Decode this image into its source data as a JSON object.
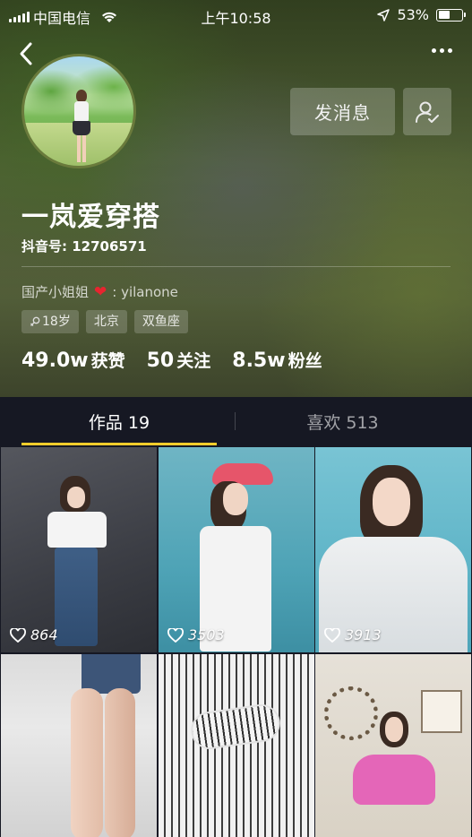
{
  "status_bar": {
    "carrier": "中国电信",
    "time": "上午10:58",
    "battery": "53%",
    "battery_level": 0.53
  },
  "profile": {
    "follow_button_label": "发消息",
    "nickname": "一岚爱穿搭",
    "douyin_id": "抖音号: 12706571",
    "bio_prefix": "国产小姐姐",
    "bio_suffix": ": yilanone",
    "tags": [
      "18岁",
      "北京",
      "双鱼座"
    ],
    "stats": [
      {
        "value": "49.0w",
        "label": "获赞"
      },
      {
        "value": "50",
        "label": "关注"
      },
      {
        "value": "8.5w",
        "label": "粉丝"
      }
    ]
  },
  "tabs": {
    "works": "作品 19",
    "likes": "喜欢 513"
  },
  "videos": [
    {
      "likes": "864"
    },
    {
      "likes": "3503"
    },
    {
      "likes": "3913"
    }
  ],
  "colors": {
    "accent": "#facd2b",
    "background": "#161823",
    "heart": "#e8242f"
  }
}
